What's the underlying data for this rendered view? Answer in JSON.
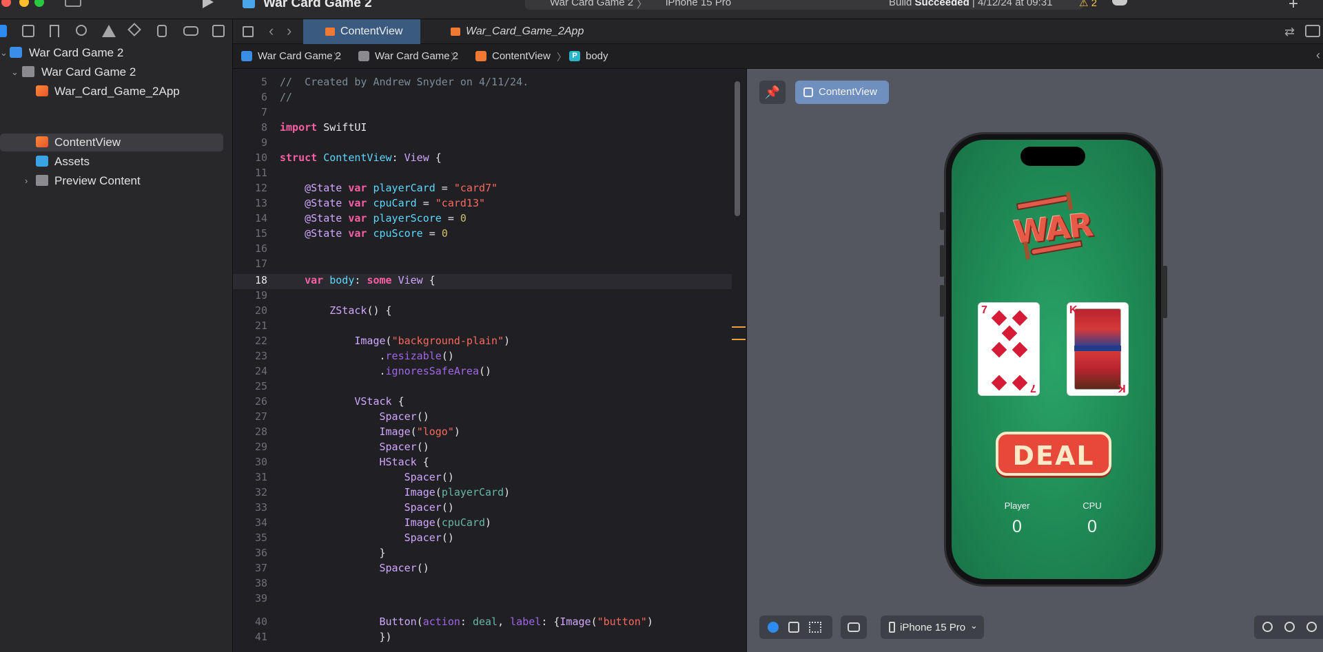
{
  "titlebar": {
    "project_title": "War Card Game 2",
    "scheme": "War Card Game 2",
    "scheme_sep": "〉",
    "device": "iPhone 15 Pro",
    "build_prefix": "Build ",
    "build_status": "Succeeded",
    "build_time": " | 4/12/24 at 09:31",
    "warnings": "⚠ 2",
    "add": "+"
  },
  "sidebar": {
    "items": [
      {
        "label": "War Card Game 2",
        "icon": "app-icon"
      },
      {
        "label": "War Card Game 2",
        "icon": "folder-icon"
      },
      {
        "label": "War_Card_Game_2App",
        "icon": "swift-file-icon"
      },
      {
        "label": "ContentView",
        "icon": "swift-file-icon",
        "selected": true
      },
      {
        "label": "Assets",
        "icon": "assets-icon"
      },
      {
        "label": "Preview Content",
        "icon": "folder-icon"
      }
    ]
  },
  "tabs": {
    "active": "ContentView",
    "inactive": "War_Card_Game_2App"
  },
  "breadcrumb": {
    "project": "War Card Game 2",
    "group": "War Card Game 2",
    "file": "ContentView",
    "symbol_badge": "P",
    "symbol": "body",
    "sep": "〉"
  },
  "code": {
    "line_numbers": [
      "5",
      "6",
      "7",
      "8",
      "9",
      "10",
      "11",
      "12",
      "13",
      "14",
      "15",
      "16",
      "17",
      "18",
      "19",
      "20",
      "21",
      "22",
      "23",
      "24",
      "25",
      "26",
      "27",
      "28",
      "29",
      "30",
      "31",
      "32",
      "33",
      "34",
      "35",
      "36",
      "37",
      "38",
      "39",
      "40",
      "41"
    ],
    "current_line": "18"
  },
  "canvas": {
    "pin": "📌",
    "preview_label": "ContentView",
    "device_label": "iPhone 15 Pro",
    "device_chevron": "⌄"
  },
  "app_preview": {
    "logo_text": "WAR",
    "player_card_rank": "7",
    "cpu_card_rank": "K",
    "deal_label": "DEAL",
    "player_label": "Player",
    "cpu_label": "CPU",
    "player_score": "0",
    "cpu_score": "0"
  },
  "colors": {
    "accent": "#2e8cf0",
    "felt_green": "#1f8a55",
    "deal_red": "#e8483a",
    "keyword": "#fc5fa3",
    "string": "#fc6a5d"
  }
}
